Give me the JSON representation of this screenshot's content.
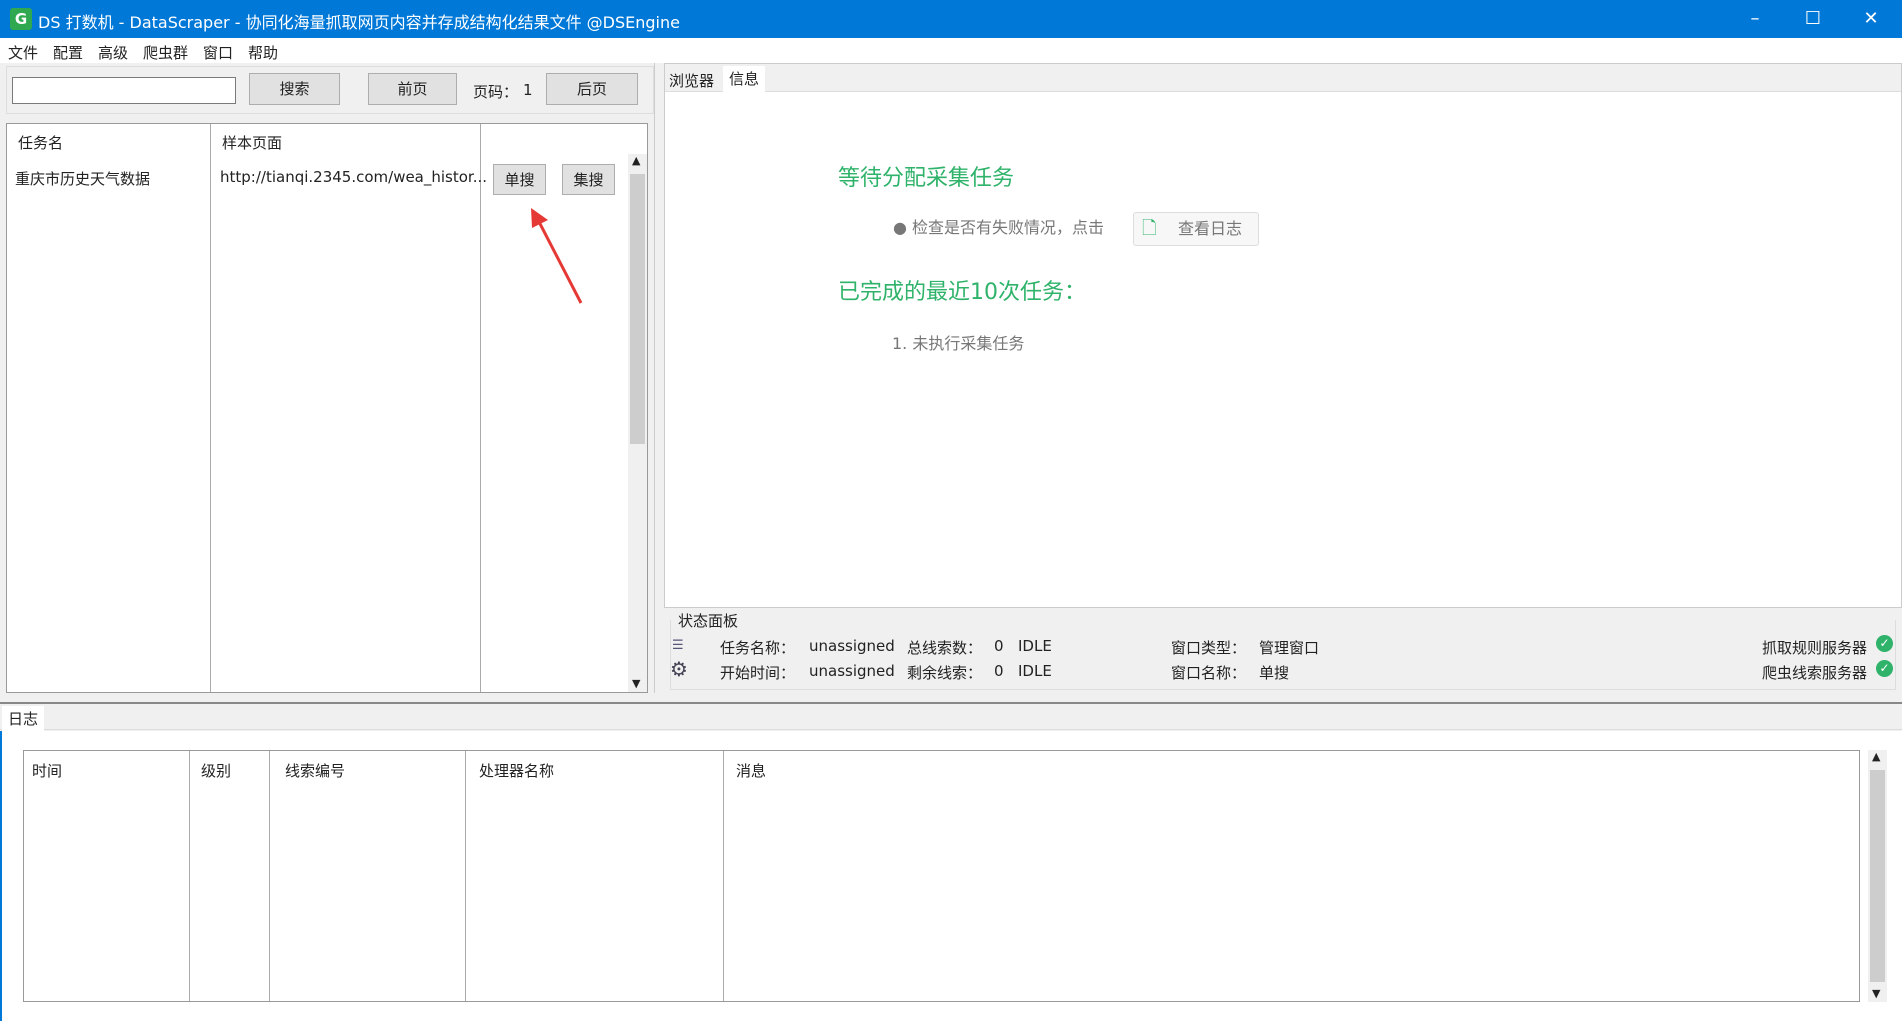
{
  "window": {
    "title": "DS 打数机 - DataScraper - 协同化海量抓取网页内容并存成结构化结果文件 @DSEngine",
    "icon": "G",
    "minimize": "–",
    "maximize": "☐",
    "close": "✕"
  },
  "menu": [
    "文件",
    "配置",
    "高级",
    "爬虫群",
    "窗口",
    "帮助"
  ],
  "toolbar": {
    "search_value": "",
    "search_button": "搜索",
    "prev_button": "前页",
    "page_label": "页码：",
    "page_number": "1",
    "next_button": "后页"
  },
  "tasks": {
    "headers": [
      "任务名",
      "样本页面"
    ],
    "rows": [
      {
        "name": "重庆市历史天气数据",
        "url": "http://tianqi.2345.com/wea_histor...",
        "single": "单搜",
        "batch": "集搜"
      }
    ]
  },
  "right_tabs": [
    {
      "label": "浏览器",
      "active": false
    },
    {
      "label": "信息",
      "active": true
    }
  ],
  "info": {
    "waiting_title": "等待分配采集任务",
    "check_text": "检查是否有失败情况，点击",
    "view_log_button": "查看日志",
    "recent_title": "已完成的最近10次任务：",
    "recent_items": [
      "1. 未执行采集任务"
    ]
  },
  "status_panel": {
    "title": "状态面板",
    "task_name_label": "任务名称：",
    "task_name": "unassigned",
    "total_label": "总线索数：",
    "total": "0",
    "total_state": "IDLE",
    "start_label": "开始时间：",
    "start": "unassigned",
    "remain_label": "剩余线索：",
    "remain": "0",
    "remain_state": "IDLE",
    "window_type_label": "窗口类型：",
    "window_type": "管理窗口",
    "window_name_label": "窗口名称：",
    "window_name": "单搜",
    "server1": "抓取规则服务器",
    "server2": "爬虫线索服务器",
    "ok_color": "#2fb36a"
  },
  "log": {
    "tab": "日志",
    "headers": [
      "时间",
      "级别",
      "线索编号",
      "处理器名称",
      "消息"
    ]
  },
  "colors": {
    "titlebar": "#0078d7",
    "accent_green": "#2fb36a",
    "arrow": "#e53935"
  }
}
